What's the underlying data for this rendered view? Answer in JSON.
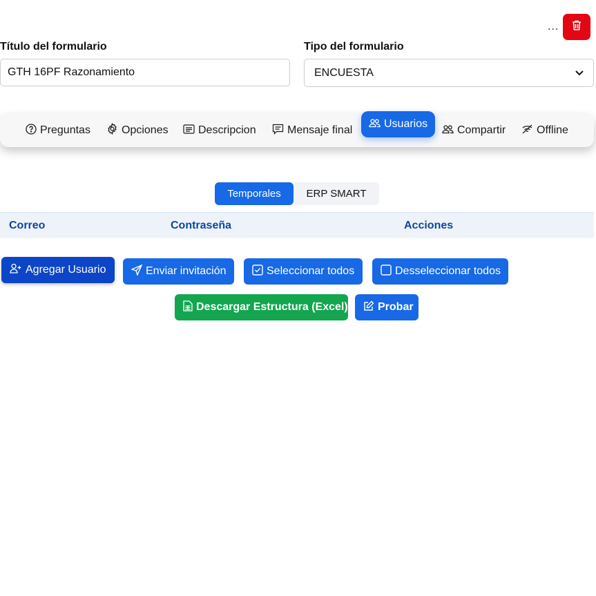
{
  "header": {
    "more_label": "...",
    "delete_icon": "trash-icon",
    "delete_color": "#e30613"
  },
  "form": {
    "title_label": "Título del formulario",
    "title_value": "GTH 16PF Razonamiento",
    "type_label": "Tipo del formulario",
    "type_value": "ENCUESTA"
  },
  "tabs": [
    {
      "label": "Preguntas",
      "icon": "question-circle-icon",
      "active": false
    },
    {
      "label": "Opciones",
      "icon": "gear-icon",
      "active": false
    },
    {
      "label": "Descripcion",
      "icon": "card-text-icon",
      "active": false
    },
    {
      "label": "Mensaje final",
      "icon": "chat-lines-icon",
      "active": false
    },
    {
      "label": "Usuarios",
      "icon": "users-icon",
      "active": true
    },
    {
      "label": "Compartir",
      "icon": "users-icon",
      "active": false
    },
    {
      "label": "Offline",
      "icon": "wifi-off-icon",
      "active": false
    }
  ],
  "subtabs": [
    {
      "label": "Temporales",
      "active": true
    },
    {
      "label": "ERP SMART",
      "active": false
    }
  ],
  "table": {
    "headers": [
      "Correo",
      "Contraseña",
      "Acciones"
    ]
  },
  "actions": {
    "add_user": "Agregar Usuario",
    "send_invite": "Enviar invitación",
    "select_all": "Seleccionar todos",
    "deselect_all": "Desseleccionar todos",
    "download": "Descargar Estructura (Excel)",
    "test": "Probar"
  },
  "colors": {
    "primary": "#1769e6",
    "primary_dark": "#0c45c7",
    "success": "#13a64f",
    "danger": "#e30613",
    "header_text": "#0d47a1"
  }
}
